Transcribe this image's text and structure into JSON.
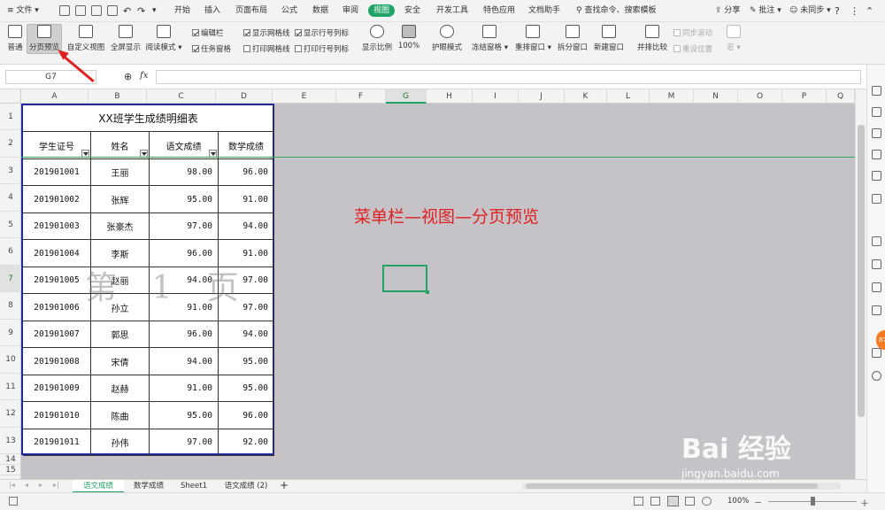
{
  "menubar": {
    "file": "≡ 文件",
    "tabs": [
      "开始",
      "插入",
      "页面布局",
      "公式",
      "数据",
      "审阅",
      "视图",
      "安全",
      "开发工具",
      "特色应用",
      "文档助手"
    ],
    "active_tab": "视图",
    "search": "查找命令、搜索模板",
    "share": "分享",
    "comment": "批注",
    "sync": "未同步",
    "help": "?",
    "more": "⋮"
  },
  "ribbon": {
    "normal": "普通",
    "page_break_preview": "分页预览",
    "custom_view": "自定义视图",
    "full_screen": "全屏显示",
    "reading_mode": "阅读模式",
    "edit_bar": "编辑栏",
    "task_pane": "任务窗格",
    "show_gridlines": "显示网格线",
    "print_gridlines": "打印网格线",
    "show_headings": "显示行号列标",
    "print_headings": "打印行号列标",
    "zoom": "显示比例",
    "zoom_100": "100%",
    "eye_protect": "护眼模式",
    "freeze": "冻结窗格",
    "arrange": "重排窗口",
    "split": "拆分窗口",
    "new_window": "新建窗口",
    "side_by_side": "并排比较",
    "sync_scroll": "同步滚动",
    "reset_position": "重设位置",
    "macro": "宏"
  },
  "formula": {
    "cell_ref": "G7",
    "fx": "fx",
    "content": ""
  },
  "columns": [
    "A",
    "B",
    "C",
    "D",
    "E",
    "F",
    "G",
    "H",
    "I",
    "J",
    "K",
    "L",
    "M",
    "N",
    "O",
    "P",
    "Q"
  ],
  "rows": [
    "1",
    "2",
    "3",
    "4",
    "5",
    "6",
    "7",
    "8",
    "9",
    "10",
    "11",
    "12",
    "13",
    "14",
    "15"
  ],
  "table": {
    "title": "XX班学生成绩明细表",
    "headers": [
      "学生证号",
      "姓名",
      "语文成绩",
      "数学成绩"
    ],
    "rows": [
      [
        "201901001",
        "王丽",
        "98.00",
        "96.00"
      ],
      [
        "201901002",
        "张辉",
        "95.00",
        "91.00"
      ],
      [
        "201901003",
        "张豪杰",
        "97.00",
        "94.00"
      ],
      [
        "201901004",
        "李斯",
        "96.00",
        "91.00"
      ],
      [
        "201901005",
        "赵丽",
        "94.00",
        "97.00"
      ],
      [
        "201901006",
        "孙立",
        "91.00",
        "97.00"
      ],
      [
        "201901007",
        "郭思",
        "96.00",
        "94.00"
      ],
      [
        "201901008",
        "宋倩",
        "94.00",
        "95.00"
      ],
      [
        "201901009",
        "赵赫",
        "91.00",
        "95.00"
      ],
      [
        "201901010",
        "陈曲",
        "95.00",
        "96.00"
      ],
      [
        "201901011",
        "孙伟",
        "97.00",
        "92.00"
      ]
    ]
  },
  "page_watermark": "第 1 页",
  "annotation": "菜单栏—视图—分页预览",
  "sheets": [
    "语文成绩",
    "数学成绩",
    "Sheet1",
    "语文成绩 (2)"
  ],
  "active_sheet": "语文成绩",
  "status": {
    "zoom": "100%"
  },
  "notification_count": "87",
  "site_watermark": "Bai 经验",
  "site_url": "jingyan.baidu.com",
  "colors": {
    "accent": "#21a366",
    "page_border": "#1f2b9c",
    "annotation": "#e02020"
  }
}
